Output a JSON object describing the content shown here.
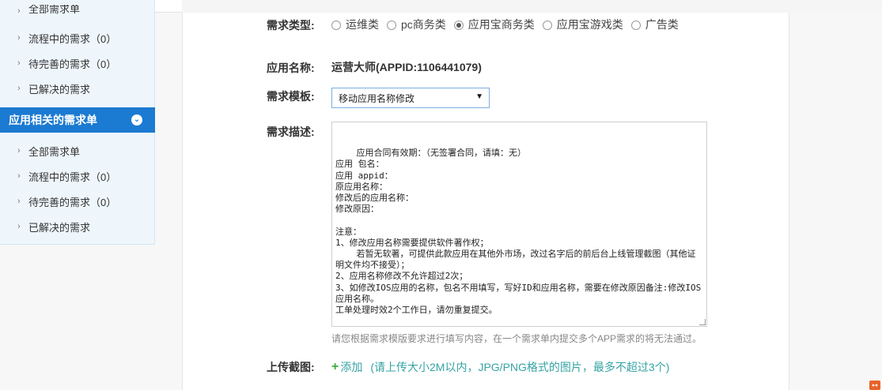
{
  "sidebar": {
    "group1_items": [
      {
        "label": "全部需求单"
      },
      {
        "label": "流程中的需求（0）"
      },
      {
        "label": "待完善的需求（0）"
      },
      {
        "label": "已解决的需求"
      }
    ],
    "group2_title": "应用相关的需求单",
    "group2_items": [
      {
        "label": "全部需求单"
      },
      {
        "label": "流程中的需求（0）"
      },
      {
        "label": "待完善的需求（0）"
      },
      {
        "label": "已解决的需求"
      }
    ]
  },
  "form": {
    "type_label": "需求类型:",
    "type_options": [
      {
        "label": "运维类",
        "selected": false
      },
      {
        "label": "pc商务类",
        "selected": false
      },
      {
        "label": "应用宝商务类",
        "selected": true
      },
      {
        "label": "应用宝游戏类",
        "selected": false
      },
      {
        "label": "广告类",
        "selected": false
      }
    ],
    "app_label": "应用名称:",
    "app_value": "运营大师(APPID:1106441079)",
    "template_label": "需求模板:",
    "template_value": "移动应用名称修改",
    "desc_label": "需求描述:",
    "desc_text": "应用合同有效期：（无签署合同，请填：无）\n应用 包名：\n应用 appid：\n原应用名称：\n修改后的应用名称：\n修改原因：\n\n注意：\n1、修改应用名称需要提供软件著作权；\n    若暂无软著，可提供此款应用在其他外市场，改过名字后的前后台上线管理截图（其他证明文件均不接受）；\n2、应用名称修改不允许超过2次；\n3、如修改IOS应用的名称，包名不用填写，写好ID和应用名称，需要在修改原因备注:修改IOS应用名称。\n工单处理时效2个工作日，请勿重复提交。",
    "desc_hint": "请您根据需求模版要求进行填写内容，在一个需求单内提交多个APP需求的将无法通过。",
    "upload_label": "上传截图:",
    "upload_add": "添加",
    "upload_note": "(请上传大小2M以内，JPG/PNG格式的图片，最多不超过3个)"
  },
  "colors": {
    "accent": "#1b7ad1",
    "sidebar_bg": "#eef6fc",
    "upload_link": "#36a3a3"
  }
}
